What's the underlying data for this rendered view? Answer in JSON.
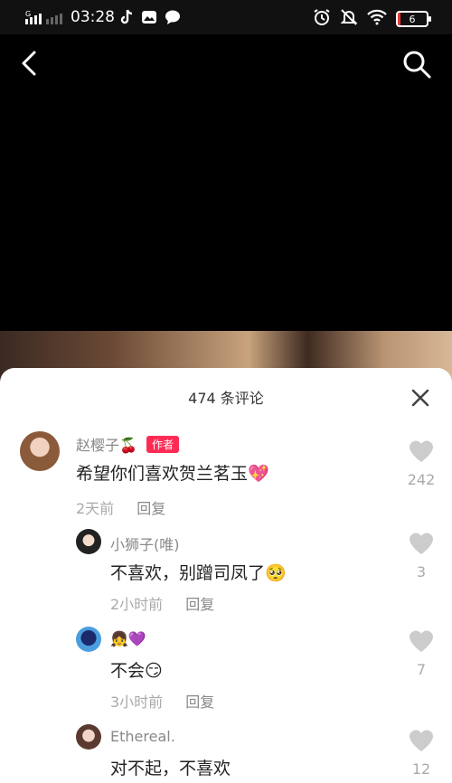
{
  "status_bar": {
    "time": "03:28",
    "signal_label": "G",
    "battery_level": "6"
  },
  "sheet": {
    "title": "474 条评论"
  },
  "comments": [
    {
      "user": "赵樱子🍒",
      "author_tag": "作者",
      "text": "希望你们喜欢贺兰茗玉💖",
      "time": "2天前",
      "reply": "回复",
      "likes": "242"
    },
    {
      "user": "小狮子(唯)",
      "text": "不喜欢，别蹭司凤了🥺",
      "time": "2小时前",
      "reply": "回复",
      "likes": "3"
    },
    {
      "user": "👧💜",
      "text": "不会😏",
      "time": "3小时前",
      "reply": "回复",
      "likes": "7"
    },
    {
      "user": "Ethereal.",
      "text": "对不起，不喜欢",
      "likes": "12"
    }
  ],
  "colors": {
    "author_tag": "#fe2c55",
    "battery_low": "#e53935"
  },
  "icons": [
    "back-icon",
    "search-icon",
    "close-icon",
    "heart-icon",
    "alarm-icon",
    "mute-icon",
    "wifi-icon",
    "tiktok-icon",
    "message-icon"
  ]
}
